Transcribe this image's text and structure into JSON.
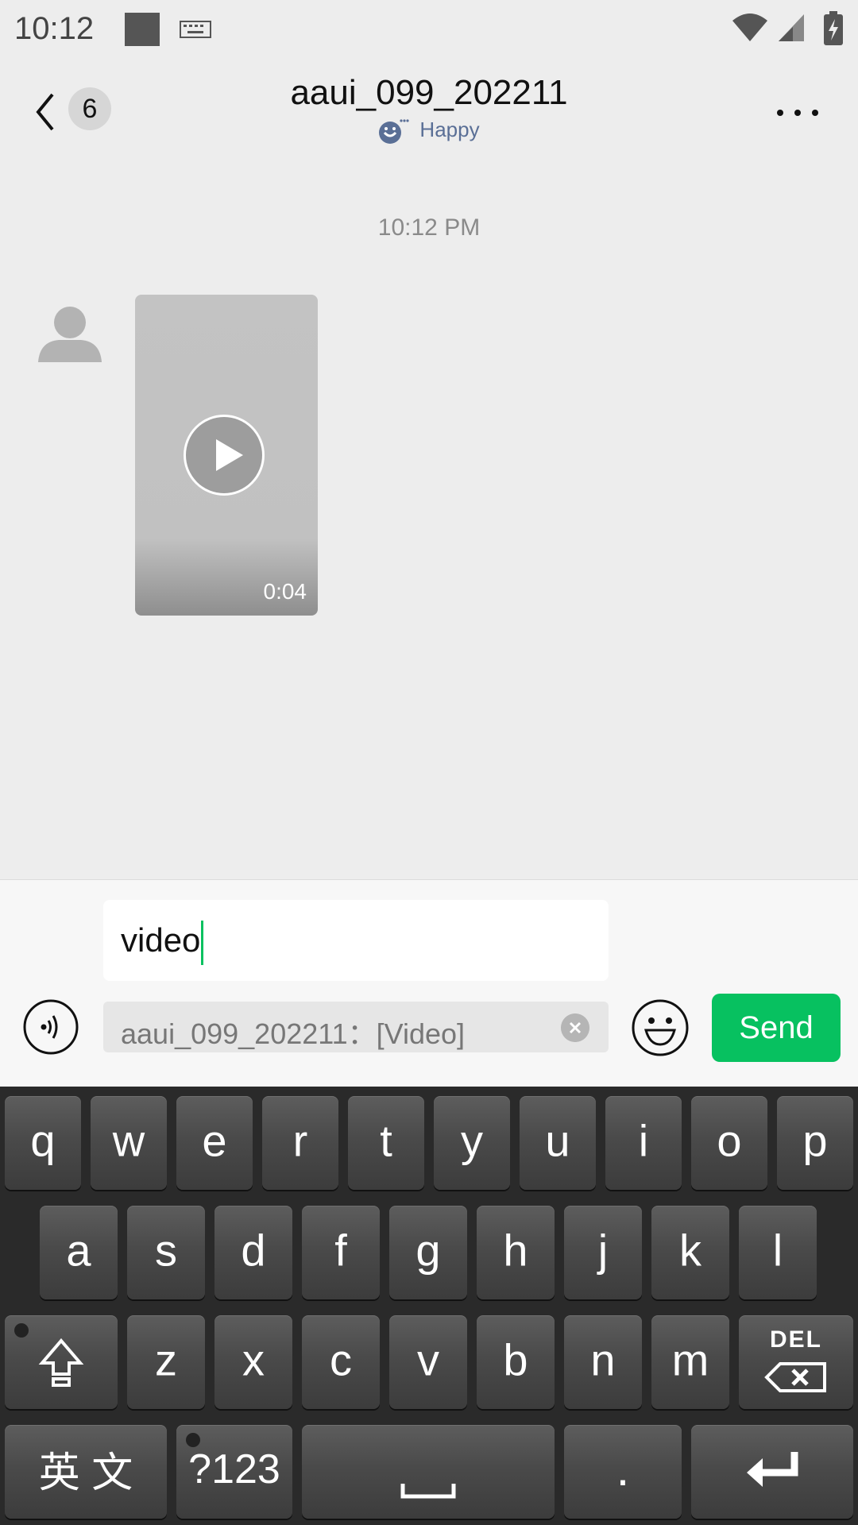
{
  "status_bar": {
    "time": "10:12"
  },
  "header": {
    "title": "aaui_099_202211",
    "unread_count": "6",
    "status_text": "Happy"
  },
  "chat": {
    "timestamp": "10:12 PM",
    "messages": [
      {
        "type": "video",
        "duration": "0:04"
      }
    ]
  },
  "input": {
    "value": "video",
    "quote_text": "aaui_099_202211：[Video]",
    "send_label": "Send"
  },
  "keyboard": {
    "row1": [
      "q",
      "w",
      "e",
      "r",
      "t",
      "y",
      "u",
      "i",
      "o",
      "p"
    ],
    "row2": [
      "a",
      "s",
      "d",
      "f",
      "g",
      "h",
      "j",
      "k",
      "l"
    ],
    "row3": [
      "z",
      "x",
      "c",
      "v",
      "b",
      "n",
      "m"
    ],
    "del_label": "DEL",
    "lang_label": "英 文",
    "num_label": "?123",
    "period_label": "."
  },
  "colors": {
    "accent": "#07c160",
    "background": "#ededed",
    "keyboard_bg": "#2a2a2a"
  },
  "icons": {
    "back": "chevron-left-icon",
    "more": "more-horizontal-icon",
    "mood": "smile-icon",
    "play": "play-icon",
    "voice": "voice-icon",
    "emoji": "emoji-icon",
    "clear": "clear-icon",
    "shift": "shift-icon",
    "delete": "backspace-icon",
    "space": "space-icon",
    "enter": "enter-icon"
  }
}
